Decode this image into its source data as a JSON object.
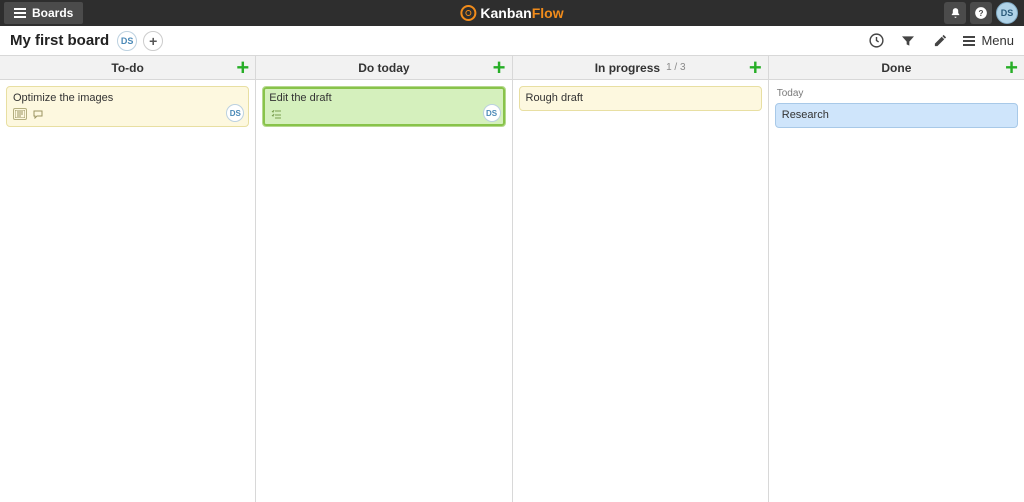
{
  "topbar": {
    "boards_label": "Boards",
    "logo_left": "Kanban",
    "logo_right": "Flow"
  },
  "user": {
    "initials": "DS"
  },
  "subbar": {
    "board_title": "My first board",
    "menu_label": "Menu"
  },
  "columns": [
    {
      "title": "To-do",
      "wip": "",
      "sublanes": [],
      "cards": [
        {
          "title": "Optimize the images",
          "color": "yellow",
          "icons": [
            "description-icon",
            "comment-icon"
          ],
          "assignee": "DS"
        }
      ]
    },
    {
      "title": "Do today",
      "wip": "",
      "sublanes": [],
      "cards": [
        {
          "title": "Edit the draft",
          "color": "green",
          "icons": [
            "subtasks-icon"
          ],
          "assignee": "DS"
        }
      ]
    },
    {
      "title": "In progress",
      "wip": "1 / 3",
      "sublanes": [],
      "cards": [
        {
          "title": "Rough draft",
          "color": "yellow",
          "icons": [],
          "assignee": ""
        }
      ]
    },
    {
      "title": "Done",
      "wip": "",
      "sublanes": [
        {
          "label": "Today",
          "cards": [
            {
              "title": "Research",
              "color": "blue",
              "icons": [],
              "assignee": ""
            }
          ]
        }
      ],
      "cards": []
    }
  ]
}
